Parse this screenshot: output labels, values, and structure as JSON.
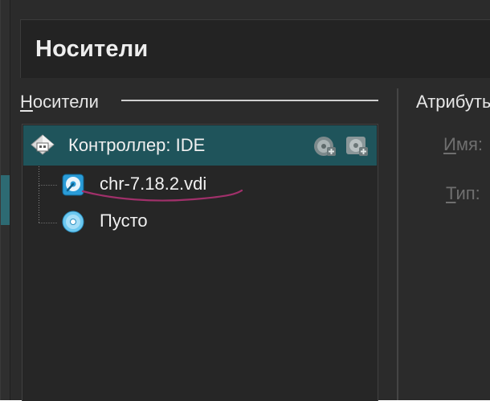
{
  "header": {
    "title": "Носители"
  },
  "storage_group": {
    "label_mnemonic": "Н",
    "label_rest": "осители"
  },
  "tree": {
    "controller": {
      "label": "Контроллер: IDE",
      "icon": "ide-controller-icon",
      "actions": [
        {
          "name": "add-hard-disk-button",
          "icon": "hdd-add-icon"
        },
        {
          "name": "add-optical-drive-button",
          "icon": "optical-add-icon"
        }
      ]
    },
    "attachments": [
      {
        "label": "chr-7.18.2.vdi",
        "icon": "hard-disk-icon",
        "annotated": true
      },
      {
        "label": "Пусто",
        "icon": "optical-disc-icon"
      }
    ]
  },
  "attributes": {
    "title": "Атрибуты",
    "name_mnemonic": "И",
    "name_rest": "мя:",
    "type_mnemonic": "Т",
    "type_rest": "ип:"
  },
  "colors": {
    "window_bg": "#2b2b2b",
    "header_bg": "#232323",
    "selection_bg": "#1f545b",
    "text": "#f0f0f0",
    "disabled_text": "#6f6f6f",
    "annotation": "#a0306a"
  }
}
